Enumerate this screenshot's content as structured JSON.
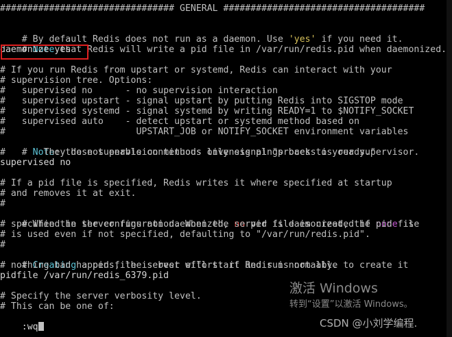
{
  "terminal": {
    "lines": [
      "################################ GENERAL #####################################",
      "",
      "# By default Redis does not run as a daemon. Use 'yes' if you need it.",
      "# Note that Redis will write a pid file in /var/run/redis.pid when daemonized.",
      "daemonize yes",
      "",
      "# If you run Redis from upstart or systemd, Redis can interact with your",
      "# supervision tree. Options:",
      "#   supervised no      - no supervision interaction",
      "#   supervised upstart - signal upstart by putting Redis into SIGSTOP mode",
      "#   supervised systemd - signal systemd by writing READY=1 to $NOTIFY_SOCKET",
      "#   supervised auto    - detect upstart or systemd method based on",
      "#                        UPSTART_JOB or NOTIFY_SOCKET environment variables",
      "# Note: these supervision methods only signal \"process is ready.\"",
      "#       They do not enable continuous liveness pings back to your supervisor.",
      "supervised no",
      "",
      "# If a pid file is specified, Redis writes it where specified at startup",
      "# and removes it at exit.",
      "#",
      "# When the server runs non daemonized, no pid file is created if none is",
      "# specified in the configuration. When the server is daemonized, the pid file",
      "# is used even if not specified, defaulting to \"/var/run/redis.pid\".",
      "#",
      "# Creating a pid file is best effort: if Redis is not able to create it",
      "# nothing bad happens, the server will start and run normally.",
      "pidfile /var/run/redis_6379.pid",
      "",
      "# Specify the server verbosity level.",
      "# This can be one of:",
      ":wq"
    ]
  },
  "colors": {
    "background": "#000000",
    "text": "#c0c0c0",
    "keyword": "#5cc3d6",
    "string_yes": "#d6c05a",
    "no": "#e0312d",
    "none": "#c45bd1",
    "highlight_border": "#e02020"
  },
  "overlay": {
    "activate_windows": "激活 Windows",
    "activate_hint": "转到“设置”以激活 Windows。",
    "credit": "CSDN @小刘学编程."
  }
}
